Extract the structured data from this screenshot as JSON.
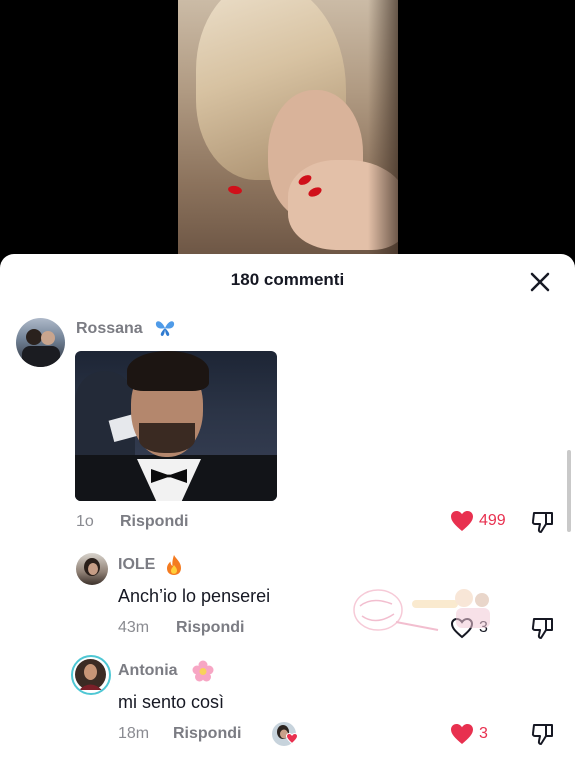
{
  "header": {
    "title": "180 commenti",
    "close_icon": "close-icon"
  },
  "colors": {
    "like_red": "#e8304f",
    "text_primary": "#161823",
    "text_secondary": "#7b7c83"
  },
  "comments": [
    {
      "username": "Rossana",
      "emoji": "butterfly",
      "attachment": "gif",
      "time": "1o",
      "reply_label": "Rispondi",
      "likes": "499",
      "liked": true
    },
    {
      "username": "IOLE",
      "emoji": "fire",
      "text": "Anch’io lo penserei",
      "time": "43m",
      "reply_label": "Rispondi",
      "likes": "3",
      "liked": false
    },
    {
      "username": "Antonia",
      "emoji": "flower",
      "text": "mi sento così",
      "time": "18m",
      "reply_label": "Rispondi",
      "likes": "3",
      "liked": true
    }
  ]
}
